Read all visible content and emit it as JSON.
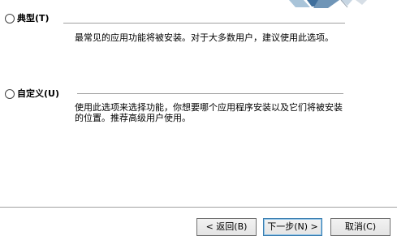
{
  "window": {
    "title": ""
  },
  "setup_type": {
    "options": [
      {
        "label": "典型(T)",
        "selected": false,
        "description": "最常见的应用功能将被安装。对于大多数用户，建议使用此选项。"
      },
      {
        "label": "自定义(U)",
        "selected": false,
        "description": "使用此选项来选择功能，你想要哪个应用程序安装以及它们将被安装的位置。推荐高级用户使用。"
      }
    ]
  },
  "footer": {
    "back_label": "< 返回(B)",
    "next_label": "下一步(N) >",
    "cancel_label": "取消(C)"
  },
  "colors": {
    "background": "#ffffff",
    "divider": "#a0a0a0",
    "default_button_border": "#3c7fb1",
    "banner_blue": "#4a7fb0"
  }
}
